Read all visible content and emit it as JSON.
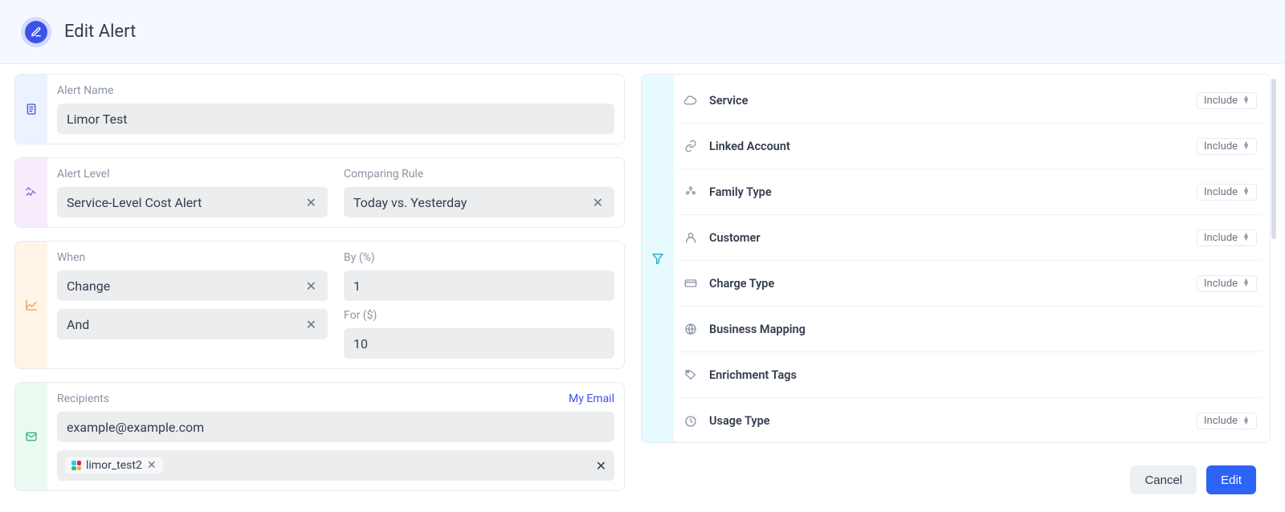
{
  "header": {
    "title": "Edit Alert"
  },
  "alert_name_block": {
    "label": "Alert Name",
    "value": "Limor Test"
  },
  "level_block": {
    "level_label": "Alert Level",
    "level_value": "Service-Level Cost Alert",
    "comparing_label": "Comparing Rule",
    "comparing_value": "Today vs. Yesterday"
  },
  "condition_block": {
    "when_label": "When",
    "when_value": "Change",
    "operator_value": "And",
    "by_label": "By (%)",
    "by_value": "1",
    "for_label": "For ($)",
    "for_value": "10"
  },
  "recipients_block": {
    "label": "Recipients",
    "my_email_link": "My Email",
    "email_value": "example@example.com",
    "slack_chip": "limor_test2"
  },
  "filters": {
    "include_label": "Include",
    "rows": [
      {
        "label": "Service",
        "has_toggle": true
      },
      {
        "label": "Linked Account",
        "has_toggle": true
      },
      {
        "label": "Family Type",
        "has_toggle": true
      },
      {
        "label": "Customer",
        "has_toggle": true
      },
      {
        "label": "Charge Type",
        "has_toggle": true
      },
      {
        "label": "Business Mapping",
        "has_toggle": false
      },
      {
        "label": "Enrichment Tags",
        "has_toggle": false
      },
      {
        "label": "Usage Type",
        "has_toggle": true
      }
    ]
  },
  "footer": {
    "cancel": "Cancel",
    "save": "Edit"
  }
}
